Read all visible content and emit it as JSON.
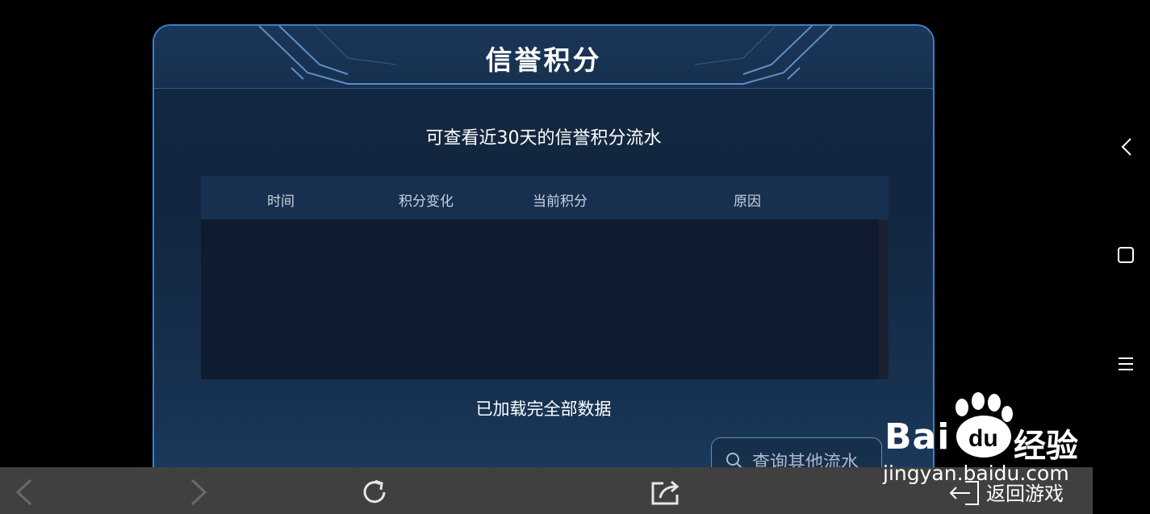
{
  "panel": {
    "title": "信誉积分",
    "subtitle": "可查看近30天的信誉积分流水",
    "columns": [
      "时间",
      "积分变化",
      "当前积分",
      "原因"
    ],
    "loaded_text": "已加载完全部数据",
    "query_button": "查询其他流水"
  },
  "bottom_bar": {
    "return_label": "返回游戏"
  },
  "watermark": {
    "main": "Bai",
    "du": "du",
    "word": "经验",
    "url": "jingyan.baidu.com"
  },
  "colors": {
    "panel_border": "#3e7fbf",
    "header_bg": "#17304f",
    "navbar_bg": "#404040"
  }
}
